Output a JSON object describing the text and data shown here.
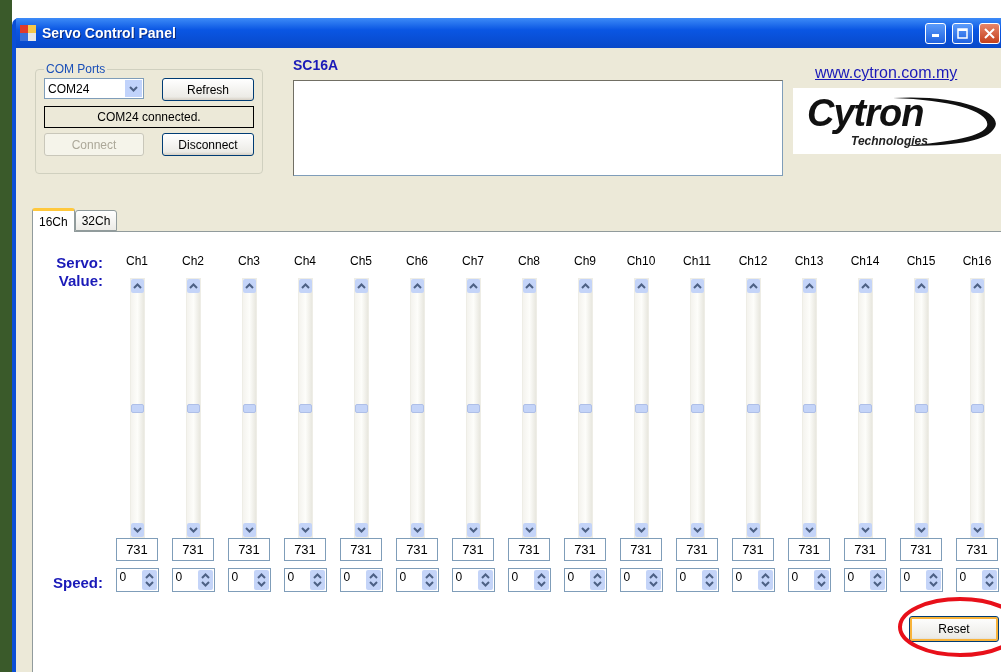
{
  "window": {
    "title": "Servo Control Panel"
  },
  "com_ports": {
    "title": "COM Ports",
    "port": "COM24",
    "refresh": "Refresh",
    "status": "COM24 connected.",
    "connect": {
      "label": "Connect",
      "disabled": true
    },
    "disconnect": {
      "label": "Disconnect",
      "disabled": false
    }
  },
  "model": "SC16A",
  "link": "www.cytron.com.my",
  "logo": {
    "name": "Cytron",
    "tagline": "Technologies"
  },
  "tabs": [
    {
      "label": "16Ch",
      "selected": true
    },
    {
      "label": "32Ch",
      "selected": false
    }
  ],
  "servo_label": "Servo:",
  "value_label": "Value:",
  "speed_label": "Speed:",
  "channels": [
    {
      "name": "Ch1",
      "level": 0.5,
      "value": "731",
      "speed": "0"
    },
    {
      "name": "Ch2",
      "level": 0.5,
      "value": "731",
      "speed": "0"
    },
    {
      "name": "Ch3",
      "level": 0.5,
      "value": "731",
      "speed": "0"
    },
    {
      "name": "Ch4",
      "level": 0.5,
      "value": "731",
      "speed": "0"
    },
    {
      "name": "Ch5",
      "level": 0.5,
      "value": "731",
      "speed": "0"
    },
    {
      "name": "Ch6",
      "level": 0.5,
      "value": "731",
      "speed": "0"
    },
    {
      "name": "Ch7",
      "level": 0.5,
      "value": "731",
      "speed": "0"
    },
    {
      "name": "Ch8",
      "level": 0.5,
      "value": "731",
      "speed": "0"
    },
    {
      "name": "Ch9",
      "level": 0.5,
      "value": "731",
      "speed": "0"
    },
    {
      "name": "Ch10",
      "level": 0.5,
      "value": "731",
      "speed": "0"
    },
    {
      "name": "Ch11",
      "level": 0.5,
      "value": "731",
      "speed": "0"
    },
    {
      "name": "Ch12",
      "level": 0.5,
      "value": "731",
      "speed": "0"
    },
    {
      "name": "Ch13",
      "level": 0.5,
      "value": "731",
      "speed": "0"
    },
    {
      "name": "Ch14",
      "level": 0.5,
      "value": "731",
      "speed": "0"
    },
    {
      "name": "Ch15",
      "level": 0.5,
      "value": "731",
      "speed": "0"
    },
    {
      "name": "Ch16",
      "level": 0.5,
      "value": "731",
      "speed": "0"
    }
  ],
  "reset": "Reset"
}
